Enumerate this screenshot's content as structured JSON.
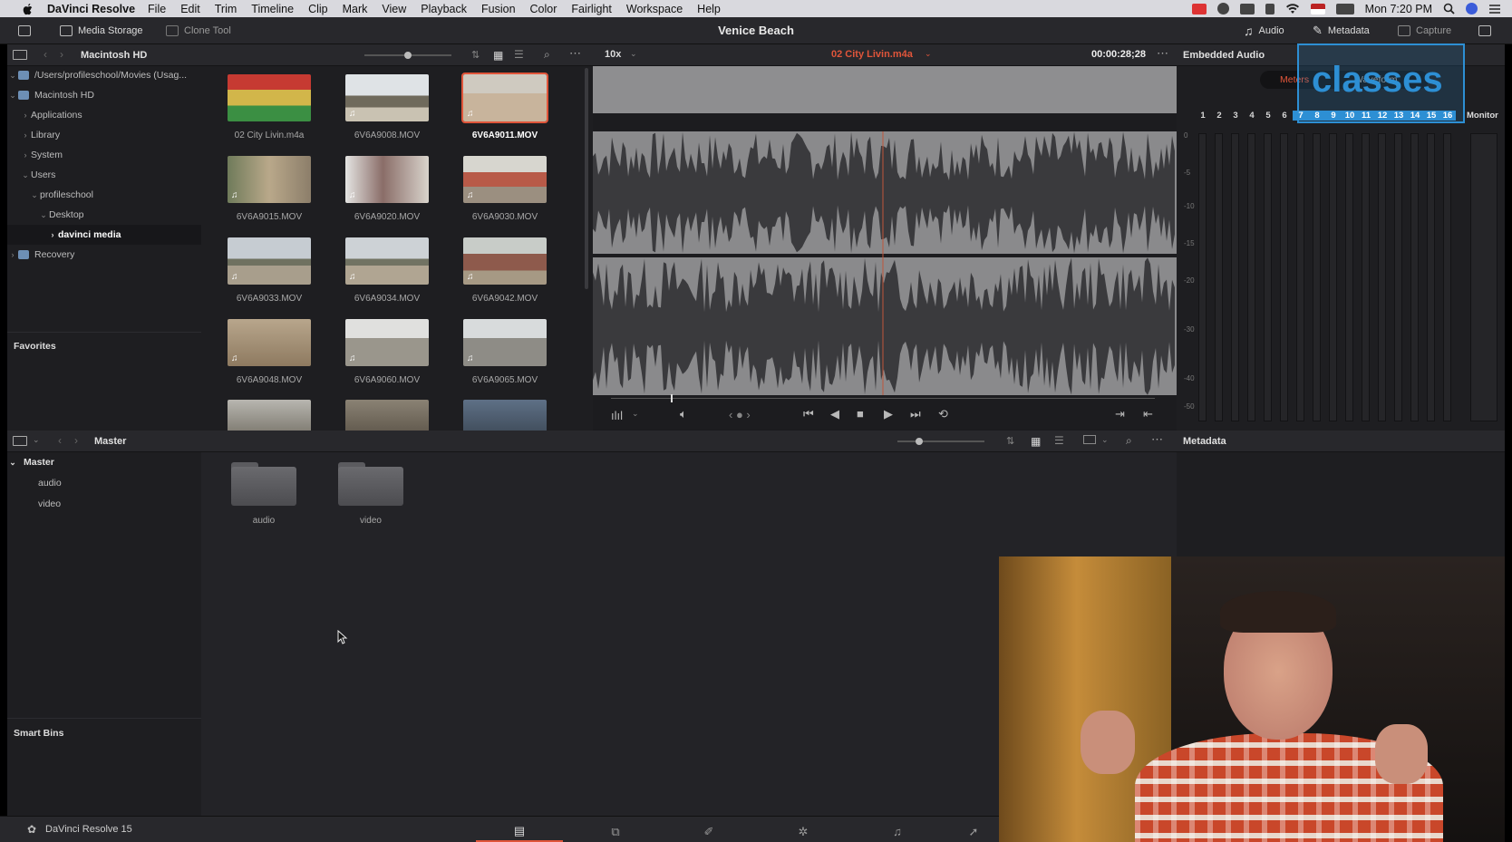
{
  "menubar": {
    "app_name": "DaVinci Resolve",
    "items": [
      "File",
      "Edit",
      "Trim",
      "Timeline",
      "Clip",
      "Mark",
      "View",
      "Playback",
      "Fusion",
      "Color",
      "Fairlight",
      "Workspace",
      "Help"
    ],
    "clock": "Mon 7:20 PM"
  },
  "header": {
    "media_storage": "Media Storage",
    "clone_tool": "Clone Tool",
    "project_title": "Venice Beach",
    "audio": "Audio",
    "metadata": "Metadata",
    "capture": "Capture"
  },
  "storage": {
    "title": "Macintosh HD",
    "tree": [
      {
        "label": "/Users/profileschool/Movies (Usag..."
      },
      {
        "label": "Macintosh HD"
      },
      {
        "label": "Applications"
      },
      {
        "label": "Library"
      },
      {
        "label": "System"
      },
      {
        "label": "Users"
      },
      {
        "label": "profileschool"
      },
      {
        "label": "Desktop"
      },
      {
        "label": "davinci media"
      },
      {
        "label": "Recovery"
      }
    ],
    "favorites": "Favorites"
  },
  "media": [
    {
      "name": "02 City Livin.m4a"
    },
    {
      "name": "6V6A9008.MOV"
    },
    {
      "name": "6V6A9011.MOV"
    },
    {
      "name": "6V6A9015.MOV"
    },
    {
      "name": "6V6A9020.MOV"
    },
    {
      "name": "6V6A9030.MOV"
    },
    {
      "name": "6V6A9033.MOV"
    },
    {
      "name": "6V6A9034.MOV"
    },
    {
      "name": "6V6A9042.MOV"
    },
    {
      "name": "6V6A9048.MOV"
    },
    {
      "name": "6V6A9060.MOV"
    },
    {
      "name": "6V6A9065.MOV"
    }
  ],
  "viewer": {
    "zoom": "10x",
    "clip_name": "02 City Livin.m4a",
    "timecode": "00:00:28;28"
  },
  "audio_panel": {
    "title": "Embedded Audio",
    "tab_meters": "Meters",
    "tab_waveform": "Waveform",
    "channels": [
      "1",
      "2",
      "3",
      "4",
      "5",
      "6",
      "7",
      "8",
      "9",
      "10",
      "11",
      "12",
      "13",
      "14",
      "15",
      "16"
    ],
    "monitor": "Monitor",
    "db_scale": [
      "0",
      "-5",
      "-10",
      "-15",
      "-20",
      "-30",
      "-40",
      "-50"
    ]
  },
  "watermark": "classes",
  "bin": {
    "title": "Master",
    "tree": [
      "Master",
      "audio",
      "video"
    ],
    "folders": [
      "audio",
      "video"
    ],
    "smart_bins": "Smart Bins"
  },
  "metadata_panel": {
    "title": "Metadata"
  },
  "footer": {
    "app_version": "DaVinci Resolve 15"
  }
}
